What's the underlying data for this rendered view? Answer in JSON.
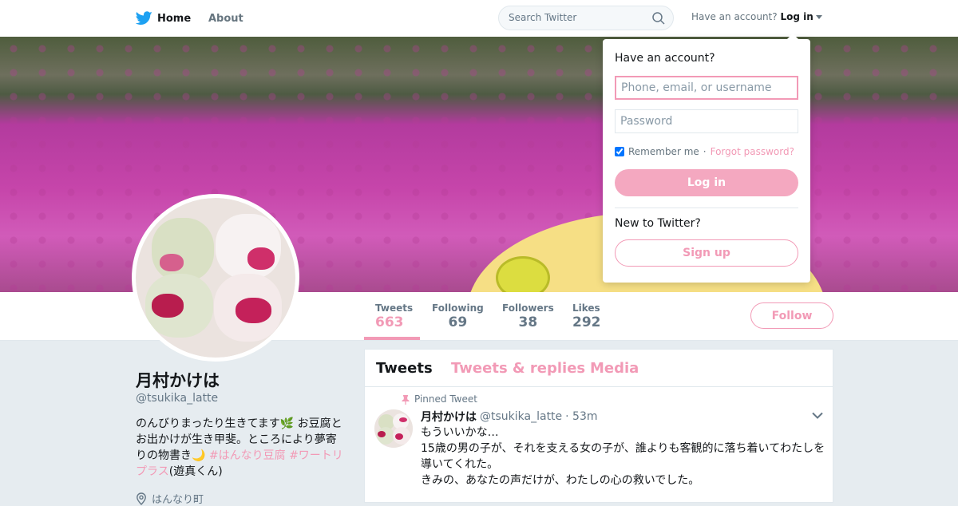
{
  "nav": {
    "home": "Home",
    "about": "About",
    "search_placeholder": "Search Twitter",
    "account_prompt": "Have an account?",
    "login_link": "Log in"
  },
  "colors": {
    "accent": "#f29ab6",
    "twitter_blue": "#1da1f2"
  },
  "profile": {
    "name": "月村かけは",
    "handle": "@tsukika_latte",
    "bio_text_1": "のんびりまったり生きてます",
    "bio_emoji_1": "🌿",
    "bio_text_2": " お豆腐とお出かけが生き甲斐。ところにより夢寄りの物書き",
    "bio_emoji_2": "🌙",
    "bio_tag_1": "#はんなり豆腐",
    "bio_tag_2": "#ワートリプラス",
    "bio_suffix": "(遊真くん)",
    "location": "はんなり町"
  },
  "stats": [
    {
      "label": "Tweets",
      "value": "663"
    },
    {
      "label": "Following",
      "value": "69"
    },
    {
      "label": "Followers",
      "value": "38"
    },
    {
      "label": "Likes",
      "value": "292"
    }
  ],
  "follow_button": "Follow",
  "tabs": [
    {
      "label": "Tweets"
    },
    {
      "label": "Tweets & replies"
    },
    {
      "label": "Media"
    }
  ],
  "tweet": {
    "pinned_label": "Pinned Tweet",
    "name": "月村かけは",
    "handle": "@tsukika_latte",
    "time": "· 53m",
    "lines": [
      "もういいかな…",
      "15歳の男の子が、それを支える女の子が、誰よりも客観的に落ち着いてわたしを導いてくれた。",
      "きみの、あなたの声だけが、わたしの心の救いでした。"
    ]
  },
  "login_dropdown": {
    "title": "Have an account?",
    "username_placeholder": "Phone, email, or username",
    "password_placeholder": "Password",
    "remember_me": "Remember me",
    "separator": "·",
    "forgot_password": "Forgot password?",
    "login_button": "Log in",
    "new_prompt": "New to Twitter?",
    "signup_button": "Sign up"
  }
}
